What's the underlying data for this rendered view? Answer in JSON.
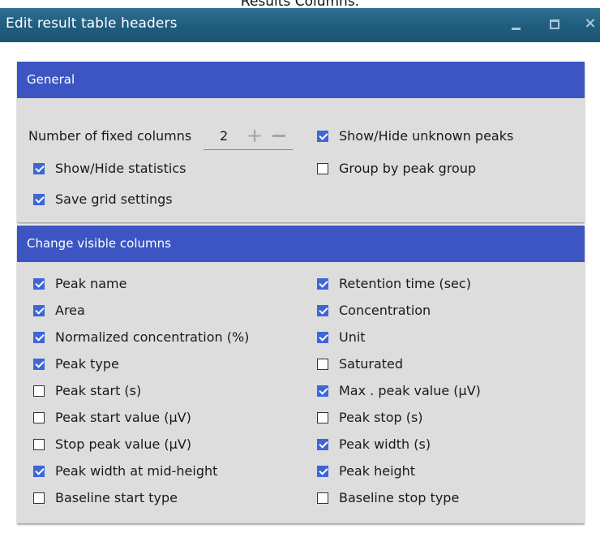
{
  "caption": "Results Columns.",
  "window": {
    "title": "Edit result table headers",
    "controls": {
      "minimize": "minimize",
      "maximize": "maximize",
      "close": "×"
    }
  },
  "general": {
    "header": "General",
    "fixed_columns_label": "Number of fixed columns",
    "fixed_columns_value": "2",
    "plus": "+",
    "options": [
      {
        "label": "Show/Hide unknown peaks",
        "checked": true
      },
      {
        "label": "Show/Hide statistics",
        "checked": true
      },
      {
        "label": "Group by peak group",
        "checked": false
      },
      {
        "label": "Save grid settings",
        "checked": true
      }
    ]
  },
  "columns": {
    "header": "Change visible columns",
    "left": [
      {
        "label": "Peak name",
        "checked": true
      },
      {
        "label": "Area",
        "checked": true
      },
      {
        "label": "Normalized concentration (%)",
        "checked": true
      },
      {
        "label": "Peak type",
        "checked": true
      },
      {
        "label": "Peak start (s)",
        "checked": false
      },
      {
        "label": "Peak start value (µV)",
        "checked": false
      },
      {
        "label": "Stop peak value (µV)",
        "checked": false
      },
      {
        "label": "Peak width at mid-height",
        "checked": true
      },
      {
        "label": "Baseline start type",
        "checked": false
      }
    ],
    "right": [
      {
        "label": "Retention time (sec)",
        "checked": true
      },
      {
        "label": "Concentration",
        "checked": true
      },
      {
        "label": "Unit",
        "checked": true
      },
      {
        "label": "Saturated",
        "checked": false
      },
      {
        "label": "Max . peak value (µV)",
        "checked": true
      },
      {
        "label": "Peak stop (s)",
        "checked": false
      },
      {
        "label": "Peak width (s)",
        "checked": true
      },
      {
        "label": "Peak height",
        "checked": true
      },
      {
        "label": "Baseline stop type",
        "checked": false
      }
    ]
  },
  "colors": {
    "title_bar": "#1f5d7e",
    "panel_header": "#3d55c2",
    "checkbox": "#3d66d9",
    "panel_bg": "#dddddd"
  }
}
